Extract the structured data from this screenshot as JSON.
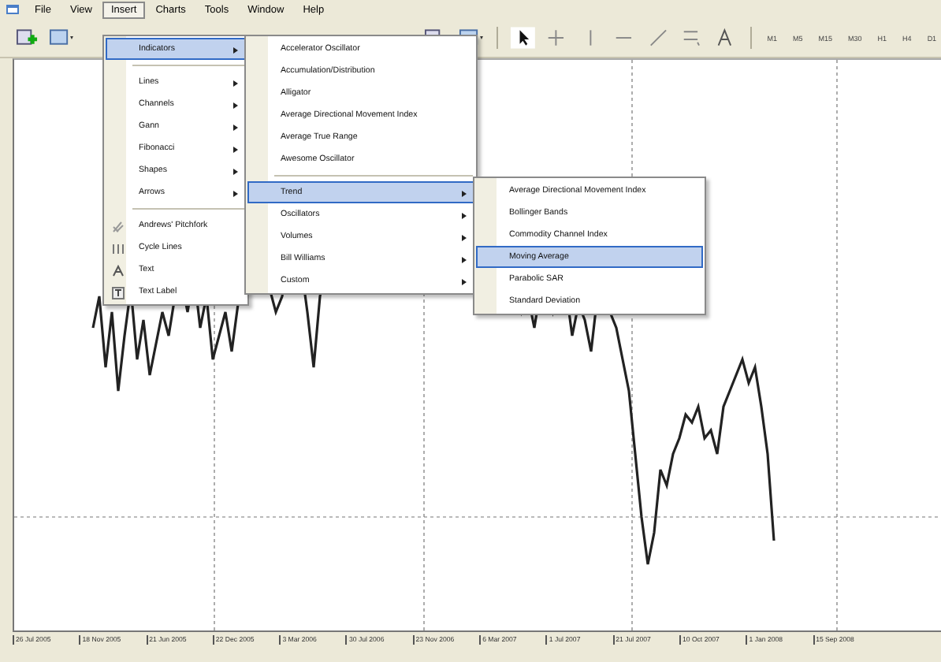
{
  "menu_bar": [
    {
      "label": "File",
      "selected": false
    },
    {
      "label": "View",
      "selected": false
    },
    {
      "label": "Insert",
      "selected": true
    },
    {
      "label": "Charts",
      "selected": false
    },
    {
      "label": "Tools",
      "selected": false
    },
    {
      "label": "Window",
      "selected": false
    },
    {
      "label": "Help",
      "selected": false
    }
  ],
  "toolbar": {
    "timeframes": [
      "M1",
      "M5",
      "M15",
      "M30",
      "H1",
      "H4",
      "D1"
    ]
  },
  "chart": {
    "date_labels": [
      "26 Jul 2005",
      "18 Nov 2005",
      "21 Jun 2005",
      "22 Dec 2005",
      "3 Mar 2006",
      "30 Jul 2006",
      "23 Nov 2006",
      "6 Mar 2007",
      "1 Jul 2007",
      "21 Jul 2007",
      "10 Oct 2007",
      "1 Jan 2008",
      "15 Sep 2008"
    ]
  },
  "menus": [
    {
      "items": [
        {
          "kind": "submenu",
          "label": "Indicators",
          "selected": true
        },
        {
          "kind": "separator"
        },
        {
          "kind": "submenu",
          "label": "Lines",
          "selected": false
        },
        {
          "kind": "submenu",
          "label": "Channels",
          "selected": false
        },
        {
          "kind": "submenu",
          "label": "Gann",
          "selected": false
        },
        {
          "kind": "submenu",
          "label": "Fibonacci",
          "selected": false
        },
        {
          "kind": "submenu",
          "label": "Shapes",
          "selected": false
        },
        {
          "kind": "submenu",
          "label": "Arrows",
          "selected": false
        },
        {
          "kind": "separator"
        },
        {
          "kind": "tool",
          "label": "Andrews' Pitchfork",
          "selected": false
        },
        {
          "kind": "tool",
          "label": "Cycle Lines",
          "selected": false
        },
        {
          "kind": "tool",
          "label": "Text",
          "selected": false
        },
        {
          "kind": "tool",
          "label": "Text Label",
          "selected": false
        }
      ]
    },
    {
      "items": [
        {
          "kind": "command",
          "label": "Accelerator Oscillator",
          "selected": false
        },
        {
          "kind": "command",
          "label": "Accumulation/Distribution",
          "selected": false
        },
        {
          "kind": "command",
          "label": "Alligator",
          "selected": false
        },
        {
          "kind": "command",
          "label": "Average Directional Movement Index",
          "selected": false
        },
        {
          "kind": "command",
          "label": "Average True Range",
          "selected": false
        },
        {
          "kind": "command",
          "label": "Awesome Oscillator",
          "selected": false
        },
        {
          "kind": "separator"
        },
        {
          "kind": "submenu",
          "label": "Trend",
          "selected": true
        },
        {
          "kind": "submenu",
          "label": "Oscillators",
          "selected": false
        },
        {
          "kind": "submenu",
          "label": "Volumes",
          "selected": false
        },
        {
          "kind": "submenu",
          "label": "Bill Williams",
          "selected": false
        },
        {
          "kind": "submenu",
          "label": "Custom",
          "selected": false
        }
      ]
    },
    {
      "items": [
        {
          "kind": "command",
          "label": "Average Directional Movement Index",
          "selected": false
        },
        {
          "kind": "command",
          "label": "Bollinger Bands",
          "selected": false
        },
        {
          "kind": "command",
          "label": "Commodity Channel Index",
          "selected": false
        },
        {
          "kind": "command",
          "label": "Moving Average",
          "selected": true
        },
        {
          "kind": "command",
          "label": "Parabolic SAR",
          "selected": false
        },
        {
          "kind": "command",
          "label": "Standard Deviation",
          "selected": false
        }
      ]
    }
  ]
}
